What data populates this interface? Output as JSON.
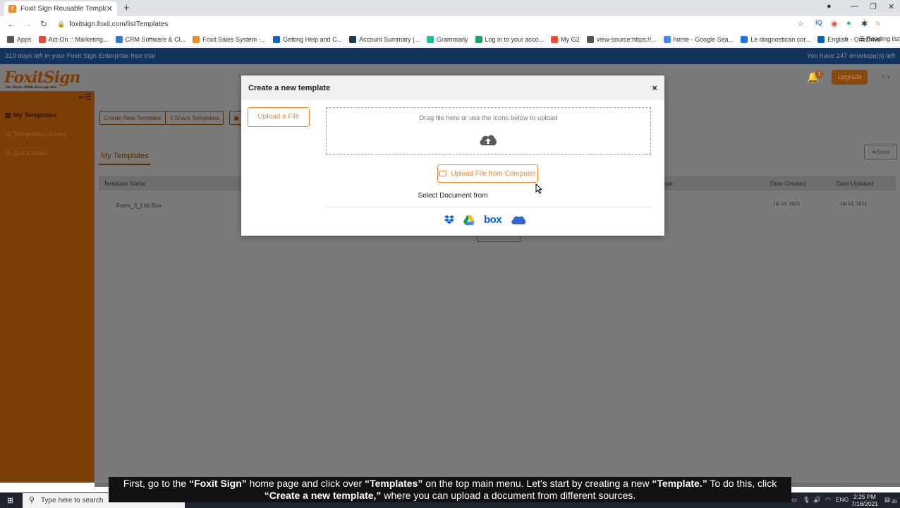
{
  "browser": {
    "tab_title": "Foxit Sign Reusable Templates",
    "url": "foxitsign.foxit.com/listTemplates",
    "bookmarks": [
      {
        "label": "Apps",
        "color": "#555555"
      },
      {
        "label": "Act-On :: Marketing...",
        "color": "#e94b3c"
      },
      {
        "label": "CRM Software & Cl...",
        "color": "#2f80c8"
      },
      {
        "label": "Foxit Sales System -...",
        "color": "#f08a24"
      },
      {
        "label": "Getting Help and C...",
        "color": "#0a66c2"
      },
      {
        "label": "Account Summary |...",
        "color": "#1a3a5c"
      },
      {
        "label": "Grammarly",
        "color": "#15c39a"
      },
      {
        "label": "Log in to your acco...",
        "color": "#1aa260"
      },
      {
        "label": "My G2",
        "color": "#ff492c"
      },
      {
        "label": "view-source:https://...",
        "color": "#555555"
      },
      {
        "label": "home - Google Sea...",
        "color": "#4285f4"
      },
      {
        "label": "Le diagnostican cor...",
        "color": "#1a73e8"
      },
      {
        "label": "English - OneDrive",
        "color": "#0364b8"
      }
    ],
    "reading_list": "Reading list",
    "more_bookmarks": "»"
  },
  "app": {
    "trial_text": "319 days left in your Foxit Sign Enterprise free trial",
    "envelopes_text": "You have 247 envelope(s) left",
    "logo_text": "FoxitSign",
    "logo_tagline": "Do More With Documents",
    "notification_count": "1",
    "upgrade_label": "Upgrade",
    "user_initials": "ff",
    "sidebar": {
      "items": [
        {
          "label": "My Templates"
        },
        {
          "label": "Templates Library"
        },
        {
          "label": "Quick Links"
        }
      ]
    },
    "toolbar": {
      "create_label": "Create New Template",
      "share_label": "Share Templates"
    },
    "section_title": "My Templates",
    "send_label": "Send",
    "table": {
      "columns": [
        "Template Name",
        "ype",
        "Date Created",
        "Date Updated"
      ],
      "rows": [
        {
          "name": "Form_3_List Box",
          "created": "Jul 14, 2021",
          "updated": "Jul 14, 2021"
        }
      ]
    }
  },
  "modal": {
    "title": "Create a new template",
    "close_label": "×",
    "upload_tab_label": "Upload a File",
    "dropzone_text": "Drag file here or use the icons below to upload",
    "computer_button_label": "Upload File from Computer",
    "select_from_label": "Select Document from",
    "providers": [
      "dropbox",
      "google-drive",
      "box",
      "onedrive"
    ],
    "box_label": "box"
  },
  "caption": {
    "line1_parts": [
      "First, go to the ",
      "“Foxit Sign”",
      " home page and click over ",
      "“Templates”",
      " on the top main menu. Let’s start by creating a new ",
      "“Template.”",
      " To do this, click"
    ],
    "line2_parts": [
      "“Create a new template,”",
      " where you can upload a document from different sources."
    ]
  },
  "taskbar": {
    "search_placeholder": "Type here to search",
    "language": "ENG",
    "time": "2:25 PM",
    "date": "7/16/2021",
    "notifications": "35"
  },
  "colors": {
    "accent_orange": "#f0822a",
    "sidebar_brown": "#7c3f09",
    "trial_bar": "#12345a"
  }
}
